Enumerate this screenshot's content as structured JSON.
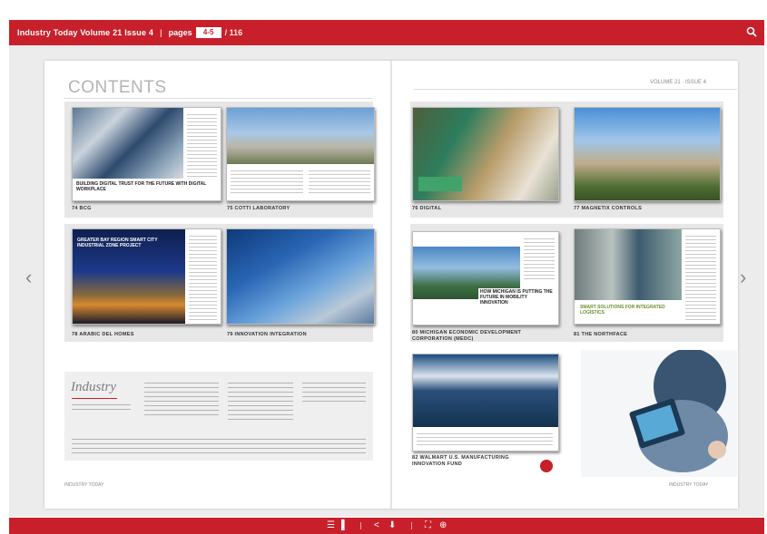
{
  "toolbar": {
    "title": "Industry Today Volume 21 Issue 4",
    "separator": "|",
    "pages_label": "pages",
    "current_page": "4-5",
    "total_pages": "/ 116",
    "search_icon": "search-icon"
  },
  "navigation": {
    "prev_icon": "chevron-left-icon",
    "next_icon": "chevron-right-icon",
    "prev_glyph": "‹",
    "next_glyph": "›"
  },
  "page": {
    "contents_title": "CONTENTS",
    "issue_info": "VOLUME 21 · ISSUE 4",
    "items": [
      {
        "number": "74",
        "label": "BCG",
        "headline": "BUILDING DIGITAL TRUST FOR THE FUTURE WITH DIGITAL WORKPLACE"
      },
      {
        "number": "75",
        "label": "COTTI LABORATORY",
        "headline": ""
      },
      {
        "number": "76",
        "label": "DIGITAL",
        "headline": ""
      },
      {
        "number": "77",
        "label": "MAGNETIX CONTROLS",
        "headline": ""
      },
      {
        "number": "78",
        "label": "ARABIC DEL HOMES",
        "headline": "GREATER BAY REGION SMART CITY INDUSTRIAL ZONE PROJECT"
      },
      {
        "number": "79",
        "label": "INNOVATION INTEGRATION",
        "headline": ""
      },
      {
        "number": "80",
        "label": "MICHIGAN ECONOMIC DEVELOPMENT CORPORATION (MEDC)",
        "headline": "HOW MICHIGAN IS PUTTING THE FUTURE IN MOBILITY INNOVATION"
      },
      {
        "number": "81",
        "label": "THE NORTHFACE",
        "headline": "SMART SOLUTIONS FOR INTEGRATED LOGISTICS"
      },
      {
        "number": "82",
        "label": "WALMART U.S. MANUFACTURING INNOVATION FUND",
        "headline": ""
      }
    ],
    "masthead_logo": "Industry",
    "footer_left": "INDUSTRY TODAY",
    "footer_right": "INDUSTRY TODAY"
  },
  "bottombar": {
    "icons": [
      "table-of-contents-icon",
      "bookmark-icon",
      "share-icon",
      "download-icon",
      "fullscreen-icon",
      "zoom-icon"
    ],
    "glyphs": [
      "☰",
      "▌",
      "<",
      "⬇",
      "⛶",
      "⊕"
    ]
  },
  "colors": {
    "brand_red": "#c8202b",
    "viewer_bg": "#ececec"
  }
}
